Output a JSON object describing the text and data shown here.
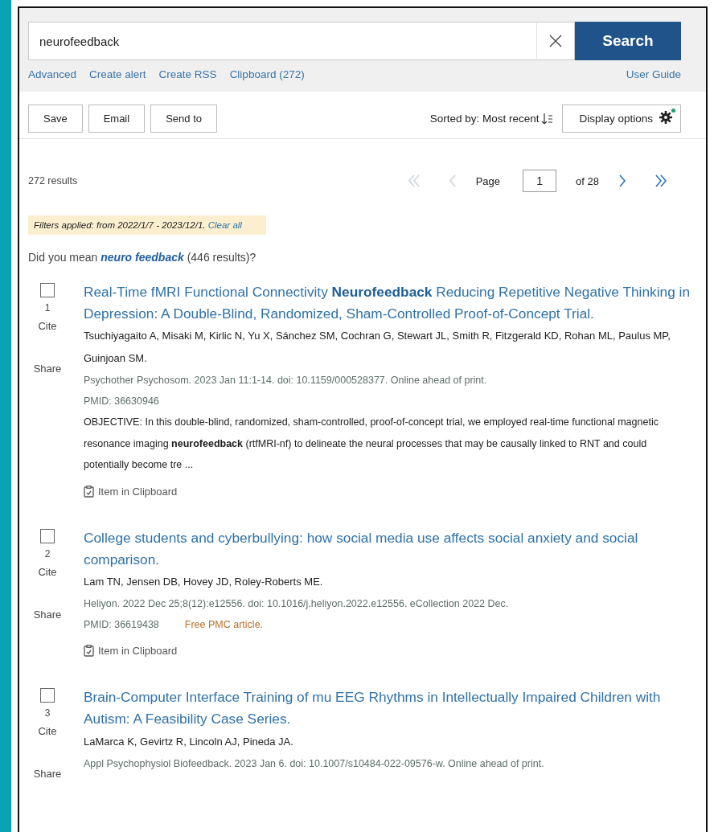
{
  "search": {
    "value": "neurofeedback",
    "button": "Search",
    "links": [
      "Advanced",
      "Create alert",
      "Create RSS",
      "Clipboard (272)"
    ],
    "guide_link": "User Guide"
  },
  "toolbar": {
    "buttons": [
      "Save",
      "Email",
      "Send to"
    ],
    "sort": "Sorted by: Most recent",
    "display_options": "Display options"
  },
  "summary": {
    "count": "272 results",
    "pager": [
      {
        "kind": "first",
        "disabled": true
      },
      {
        "kind": "prev",
        "disabled": true
      },
      {
        "kind": "label",
        "text": "Page"
      },
      {
        "kind": "input",
        "text": "1"
      },
      {
        "kind": "label",
        "text": "of 28"
      },
      {
        "kind": "next",
        "disabled": false
      },
      {
        "kind": "last",
        "disabled": false
      }
    ]
  },
  "filters": {
    "text": "Filters applied: from 2022/1/7 - 2023/12/1.",
    "clear": "Clear all"
  },
  "suggestion": {
    "before": "Did you mean",
    "term": "neuro feedback",
    "after": "(446 results)?"
  },
  "results": [
    {
      "checked": false,
      "number": "1",
      "actions": [
        "Cite",
        "Share"
      ],
      "title": "Real-Time fMRI Functional Connectivity **Neurofeedback** Reducing Repetitive Negative Thinking in Depression: A Double-Blind, Randomized, Sham-Controlled Proof-of-Concept Trial.",
      "authors": "Tsuchiyagaito A, Misaki M, Kirlic N, Yu X, Sánchez SM, Cochran G, Stewart JL, Smith R, Fitzgerald KD, Rohan ML, Paulus MP, Guinjoan SM.",
      "citation": "Psychother Psychosom. 2023 Jan 11:1-14. doi: 10.1159/000528377. Online ahead of print.",
      "pmid": "PMID: 36630946",
      "abstract": "OBJECTIVE: In this double-blind, randomized, sham-controlled, proof-of-concept trial, we employed real-time functional magnetic resonance imaging **neurofeedback** (rtfMRI-nf) to delineate the neural processes that may be causally linked to RNT and could potentially become tre ...",
      "clipboard": "Item in Clipboard"
    },
    {
      "checked": false,
      "number": "2",
      "actions": [
        "Cite",
        "Share"
      ],
      "title": "College students and cyberbullying: how social media use affects social anxiety and social comparison.",
      "authors": "Lam TN, Jensen DB, Hovey JD, Roley-Roberts ME.",
      "citation": "Heliyon. 2022 Dec 25;8(12):e12556. doi: 10.1016/j.heliyon.2022.e12556. eCollection 2022 Dec.",
      "pmid": "PMID: 36619438",
      "free": "Free PMC article.",
      "clipboard": "Item in Clipboard"
    },
    {
      "checked": false,
      "number": "3",
      "actions": [
        "Cite",
        "Share"
      ],
      "title": "Brain-Computer Interface Training of mu EEG Rhythms in Intellectually Impaired Children with Autism: A Feasibility Case Series.",
      "authors": "LaMarca K, Gevirtz R, Lincoln AJ, Pineda JA.",
      "citation": "Appl Psychophysiol Biofeedback. 2023 Jan 6. doi: 10.1007/s10484-022-09576-w. Online ahead of print."
    }
  ]
}
